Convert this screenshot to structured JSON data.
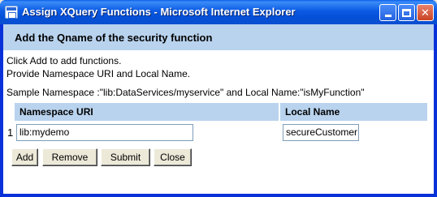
{
  "window": {
    "title": "Assign XQuery Functions - Microsoft Internet Explorer",
    "app_icon": "ie-page-icon",
    "controls": {
      "minimize_icon": "minimize-icon",
      "maximize_icon": "maximize-icon",
      "close_icon": "close-icon",
      "close_glyph": "✕"
    }
  },
  "header": {
    "title": "Add the Qname of the security function"
  },
  "instructions": {
    "line1": "Click Add to add functions.",
    "line2": "Provide Namespace URI and Local Name.",
    "line3": "Sample Namespace :\"lib:DataServices/myservice\" and Local Name:\"isMyFunction\""
  },
  "table": {
    "columns": [
      "Namespace URI",
      "Local Name"
    ],
    "rows": [
      {
        "index": "1",
        "namespace_uri": "lib:mydemo",
        "local_name": "secureCustomer"
      }
    ]
  },
  "buttons": {
    "add": "Add",
    "remove": "Remove",
    "submit": "Submit",
    "close": "Close"
  },
  "colors": {
    "titlebar_blue": "#0a5fe8",
    "header_band": "#b9d3ee",
    "button_face": "#ece9d8",
    "close_red": "#c94424"
  }
}
